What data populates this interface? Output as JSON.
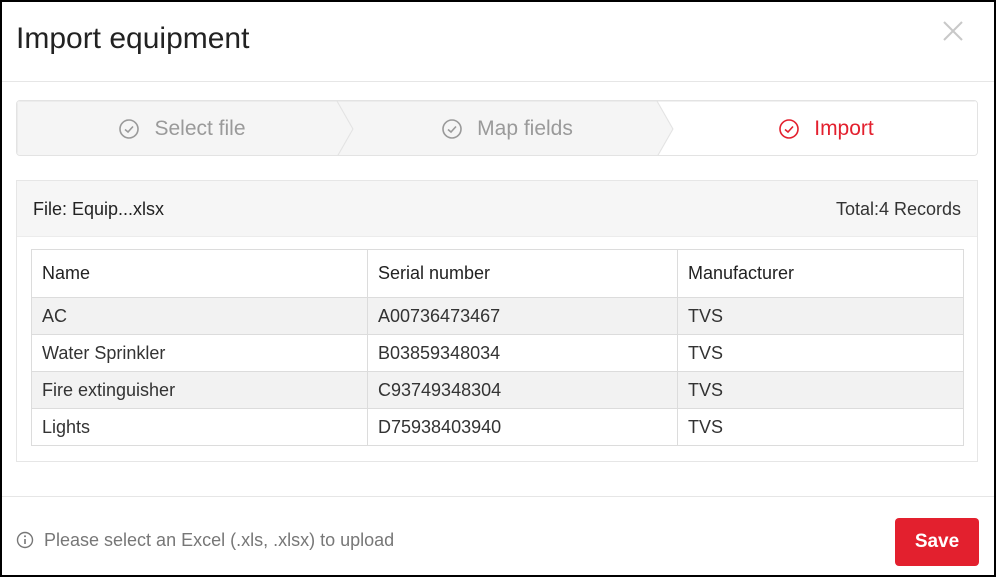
{
  "dialog": {
    "title": "Import equipment"
  },
  "stepper": {
    "steps": [
      {
        "label": "Select file",
        "state": "done"
      },
      {
        "label": "Map fields",
        "state": "done"
      },
      {
        "label": "Import",
        "state": "active"
      }
    ]
  },
  "panel": {
    "file_label": "File: Equip...xlsx",
    "total_label": "Total:4 Records"
  },
  "table": {
    "headers": [
      "Name",
      "Serial number",
      "Manufacturer"
    ],
    "rows": [
      [
        "AC",
        "A00736473467",
        "TVS"
      ],
      [
        "Water Sprinkler",
        "B03859348034",
        "TVS"
      ],
      [
        "Fire extinguisher",
        "C93749348304",
        "TVS"
      ],
      [
        "Lights",
        "D75938403940",
        "TVS"
      ]
    ]
  },
  "footer": {
    "info_text": "Please select an Excel (.xls, .xlsx) to upload",
    "save_label": "Save"
  },
  "colors": {
    "accent": "#e3202e",
    "muted": "#9a9a9a",
    "step_done_bg": "#f5f5f5"
  },
  "icons": {
    "close": "close-icon",
    "step": "check-circle-icon",
    "info": "info-icon"
  }
}
